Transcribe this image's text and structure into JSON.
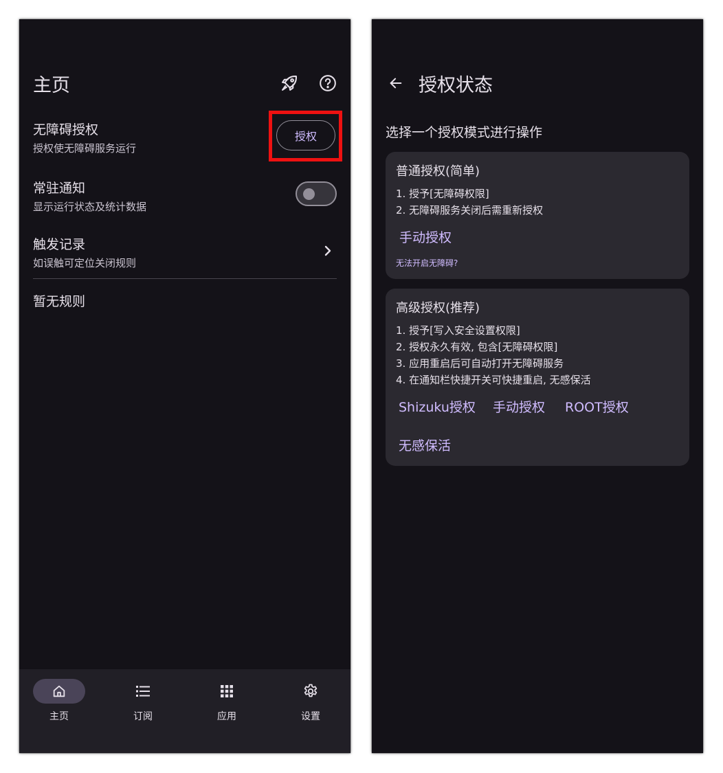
{
  "left_screen": {
    "title": "主页",
    "icons": {
      "rocket": "rocket-icon",
      "help": "help-circle-icon"
    },
    "accessibility": {
      "title": "无障碍授权",
      "subtitle": "授权使无障碍服务运行",
      "button_label": "授权"
    },
    "persistent_notification": {
      "title": "常驻通知",
      "subtitle": "显示运行状态及统计数据",
      "enabled": false
    },
    "trigger_log": {
      "title": "触发记录",
      "subtitle": "如误触可定位关闭规则"
    },
    "empty_rules_text": "暂无规则",
    "bottom_nav": [
      {
        "label": "主页",
        "icon": "home-icon",
        "active": true
      },
      {
        "label": "订阅",
        "icon": "list-icon",
        "active": false
      },
      {
        "label": "应用",
        "icon": "apps-grid-icon",
        "active": false
      },
      {
        "label": "设置",
        "icon": "gear-icon",
        "active": false
      }
    ]
  },
  "right_screen": {
    "title": "授权状态",
    "prompt": "选择一个授权模式进行操作",
    "basic_card": {
      "title": "普通授权(简单)",
      "lines": [
        "1. 授予[无障碍权限]",
        "2. 无障碍服务关闭后需重新授权"
      ],
      "manual_button": "手动授权",
      "help_link": "无法开启无障碍?"
    },
    "advanced_card": {
      "title": "高级授权(推荐)",
      "lines": [
        "1. 授予[写入安全设置权限]",
        "2. 授权永久有效, 包含[无障碍权限]",
        "3. 应用重启后可自动打开无障碍服务",
        "4. 在通知栏快捷开关可快捷重启, 无感保活"
      ],
      "buttons": [
        "Shizuku授权",
        "手动授权",
        "ROOT授权",
        "无感保活"
      ]
    }
  },
  "colors": {
    "background": "#141218",
    "surface": "#2b2930",
    "nav_bar": "#211f26",
    "accent": "#d0bcff",
    "highlight": "#ee1111",
    "text": "#e6e0e9"
  }
}
